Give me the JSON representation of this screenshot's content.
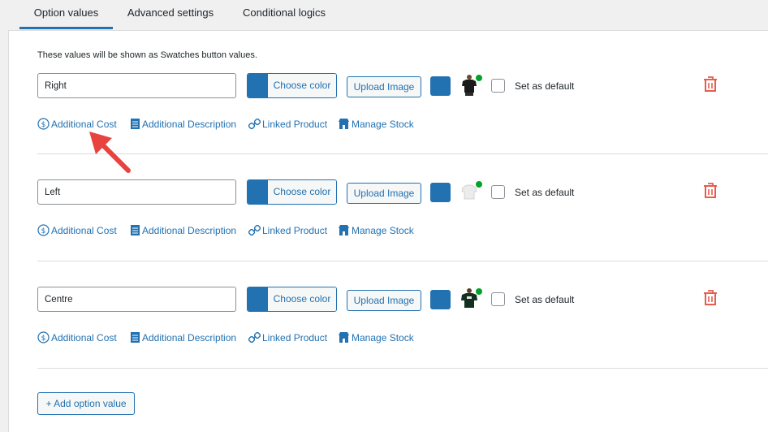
{
  "tabs": [
    {
      "label": "Option values",
      "active": true
    },
    {
      "label": "Advanced settings",
      "active": false
    },
    {
      "label": "Conditional logics",
      "active": false
    }
  ],
  "hint": "These values will be shown as Swatches button values.",
  "options": [
    {
      "value": "Right",
      "color_label": "Choose color",
      "upload_label": "Upload Image",
      "thumb_icon": "tshirt-black-icon",
      "default_label": "Set as default"
    },
    {
      "value": "Left",
      "color_label": "Choose color",
      "upload_label": "Upload Image",
      "thumb_icon": "tshirt-white-icon",
      "default_label": "Set as default"
    },
    {
      "value": "Centre",
      "color_label": "Choose color",
      "upload_label": "Upload Image",
      "thumb_icon": "tshirt-black-icon",
      "default_label": "Set as default"
    }
  ],
  "links": {
    "cost": "Additional Cost",
    "description": "Additional Description",
    "linked": "Linked Product",
    "stock": "Manage Stock"
  },
  "add_button": "+ Add option value",
  "colors": {
    "accent": "#2271b1",
    "danger": "#e65c4f",
    "arrow": "#e8433e",
    "online": "#00a32a"
  }
}
